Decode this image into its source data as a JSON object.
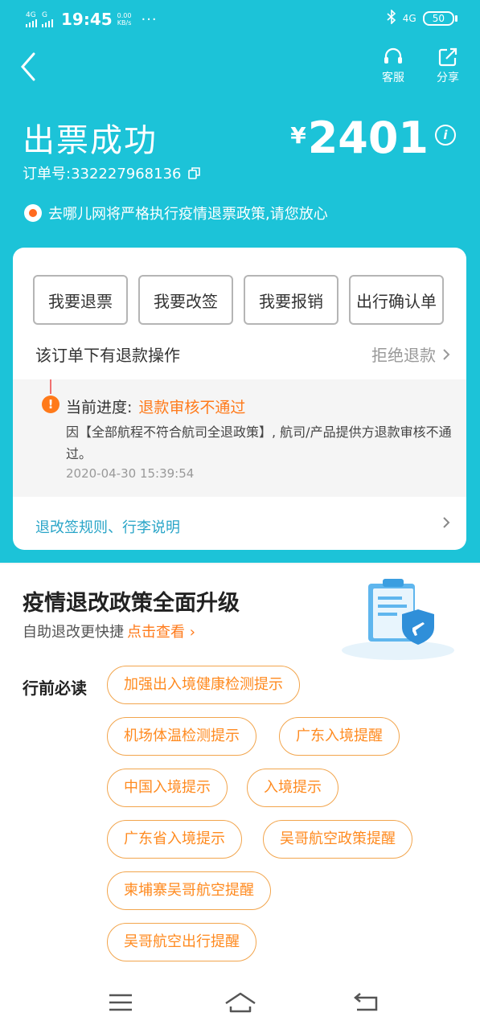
{
  "status_bar": {
    "sig1": "4G",
    "sig2": "G",
    "time": "19:45",
    "speed_value": "0.00",
    "speed_unit": "KB/s",
    "dots": "···",
    "net": "4G",
    "battery": "50"
  },
  "header": {
    "service_label": "客服",
    "share_label": "分享"
  },
  "ticket": {
    "title": "出票成功",
    "currency": "¥",
    "price": "2401",
    "order_no": "订单号:332227968136"
  },
  "notice": "去哪儿网将严格执行疫情退票政策,请您放心",
  "actions": [
    "我要退票",
    "我要改签",
    "我要报销",
    "出行确认单"
  ],
  "refund": {
    "label": "该订单下有退款操作",
    "status": "拒绝退款"
  },
  "progress": {
    "label": "当前进度:",
    "value": "退款审核不通过",
    "desc": "因【全部航程不符合航司全退政策】, 航司/产品提供方退款审核不通过。",
    "time": "2020-04-30 15:39:54"
  },
  "rules_link": "退改签规则、行李说明",
  "upgrade": {
    "title": "疫情退改政策全面升级",
    "subtitle": "自助退改更快捷",
    "link": "点击查看 ›"
  },
  "must_read": {
    "label": "行前必读",
    "tags": [
      "加强出入境健康检测提示",
      "机场体温检测提示",
      "广东入境提醒",
      "中国入境提示",
      "入境提示",
      "广东省入境提示",
      "吴哥航空政策提醒",
      "柬埔寨吴哥航空提醒",
      "吴哥航空出行提醒"
    ]
  },
  "colors": {
    "primary": "#1cc3d8",
    "accent": "#ff7a1a",
    "link": "#2aa5c8",
    "tag_border": "#f2a54d"
  }
}
